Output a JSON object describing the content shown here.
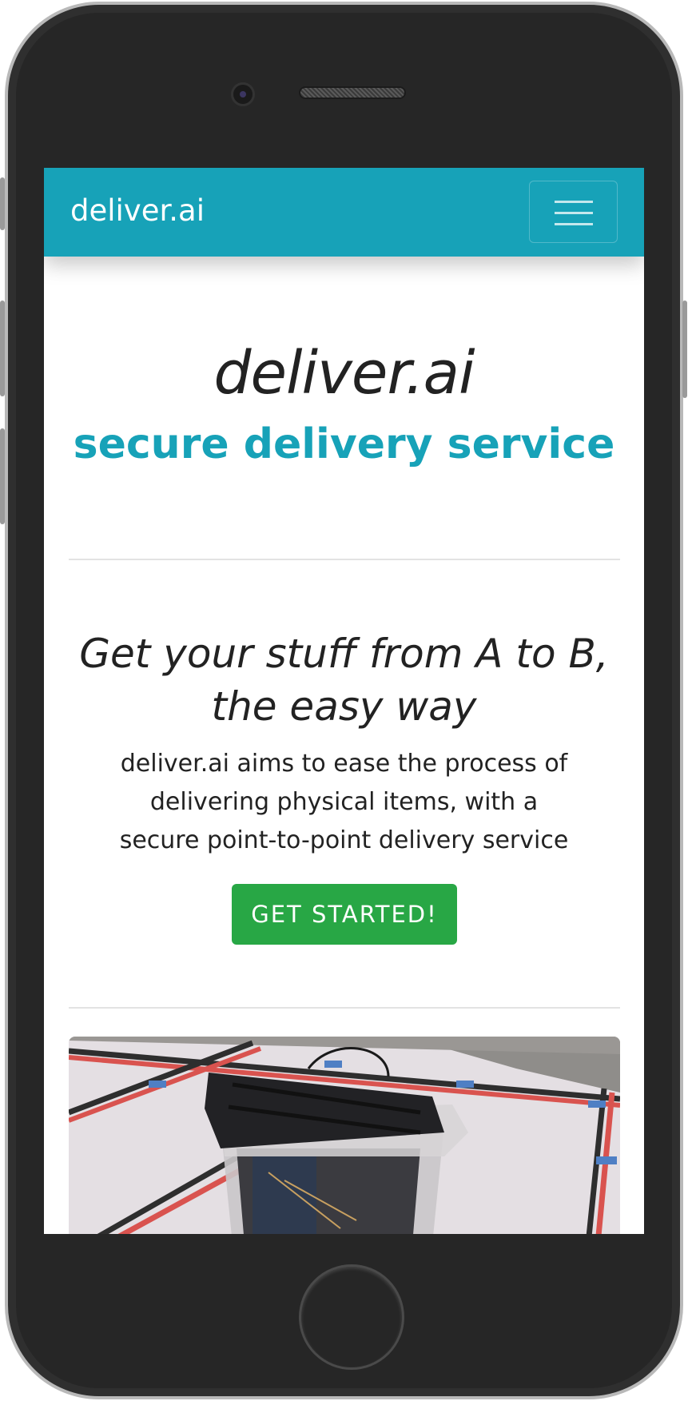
{
  "navbar": {
    "brand": "deliver.ai",
    "toggler_icon": "hamburger-menu-icon"
  },
  "hero": {
    "title": "deliver.ai",
    "subtitle": "secure delivery service"
  },
  "intro": {
    "tagline_line1": "Get your stuff from A to B,",
    "tagline_line2": "the easy way",
    "description": "deliver.ai aims to ease the process of delivering physical items, with a secure point-to-point delivery service",
    "cta_label": "GET STARTED!"
  },
  "colors": {
    "primary": "#17a2b8",
    "success": "#28a745",
    "text": "#222222",
    "divider": "#e3e3e3"
  }
}
